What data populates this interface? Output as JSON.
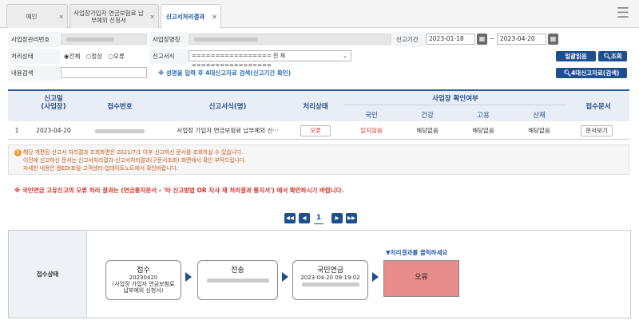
{
  "tabs": [
    {
      "label": "메인",
      "active": false
    },
    {
      "label": "사업장가입자 연금보험료 납부예외 신청서",
      "active": false
    },
    {
      "label": "신고서처리결과",
      "active": true
    }
  ],
  "menu_icon": "menu-lines-close-icon",
  "filters": {
    "biz_no_label": "사업장관리번호",
    "biz_name_label": "사업장명칭",
    "period_label": "신고기간",
    "date_from": "2023-01-18",
    "date_sep": "~",
    "date_to": "2023-04-20",
    "status_label": "처리상태",
    "status_options": [
      "◉전체",
      "○정상",
      "○오류"
    ],
    "form_label": "신고서식",
    "form_value": "================= 전 체 =================",
    "search_label": "내용검색",
    "search_hint": "※ 성명을 입력 후 4대신고자료 검색(신고기간 확인)",
    "btn_bulk_read": "일괄읽음",
    "btn_search": "조회",
    "btn_search_4": "4대신고자료(검색)"
  },
  "table": {
    "headers": {
      "date": "신고일\n(사업장)",
      "receipt_no": "접수번호",
      "form_name": "신고서식(명)",
      "status": "처리상태",
      "confirm_group": "사업장 확인여부",
      "pension": "국민",
      "health": "건강",
      "employment": "고용",
      "industrial": "산재",
      "doc": "접수문서"
    },
    "rows": [
      {
        "no": "1",
        "date": "2023-04-20",
        "form_name": "사업장 가입자 연금보험료 납부예외 신···",
        "status": "오류",
        "pension": "읽지않음",
        "health": "해당없음",
        "employment": "해당없음",
        "industrial": "해당없음",
        "doc_button": "문서보기"
      }
    ]
  },
  "notice": {
    "lines": [
      "해당 개편된 신고서 처리결과 조회화면은 2021/7/1 이후 신고하신 문서를 조회하실 수 있습니다.",
      "이전에 신고하신 문서는 신고서처리결과-신고서처리결과(구문서조회) 화면에서 확인 부탁드립니다.",
      "자세한 내용은 웹EDI포털-고객센터-업데이트노트에서 확인바랍니다."
    ],
    "warning": "※ 국민연금 고유신고의 오류 처리 결과는 (연금통지문서 - '타 신고방법 OR 지사 재 처리결과 통지서') 에서 확인하시기 바랍니다."
  },
  "pagination": {
    "first": "◀◀",
    "prev": "◀",
    "current": "1",
    "next": "▶",
    "last": "▶▶"
  },
  "status_flow": {
    "label": "접수상태",
    "hint": "▼처리결과를 클릭하세요",
    "step1_title": "접수",
    "step1_date": "20230420",
    "step1_desc": "(사업장 가입자 연금보험료 납부예외 신청서)",
    "step2_title": "전송",
    "step3_title": "국민연금",
    "step3_time": "2023-04-20 09:19:02",
    "result": "오류"
  },
  "colors": {
    "accent": "#1d4f8f",
    "error": "#e0302a",
    "result_bg": "#e88b8b",
    "notice_text": "#c95d16"
  }
}
